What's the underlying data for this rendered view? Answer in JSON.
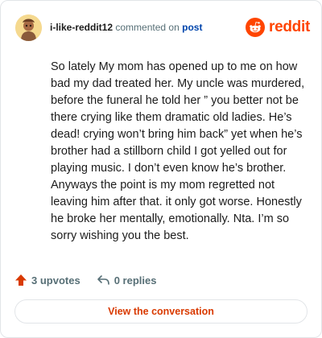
{
  "header": {
    "username": "i-like-reddit12",
    "commented_text": "commented on",
    "post_link": "post",
    "brand_name": "reddit",
    "brand_color": "#ff4500",
    "avatar_icon": "cartoon-avatar-icon",
    "brand_icon": "reddit-alien-icon"
  },
  "comment": {
    "body": "So lately My mom has opened up to me on how bad my dad treated her. My uncle was murdered, before the funeral he told her ” you better not be there crying like them dramatic old ladies. He’s dead! crying won’t bring him back” yet when he’s brother had a stillborn child I got yelled out for playing music. I don’t even know he’s brother. Anyways the point is my mom regretted not leaving him after that. it only got worse. Honestly he broke her mentally, emotionally. Nta. I’m so sorry wishing you the best."
  },
  "footer": {
    "upvotes_label": "3 upvotes",
    "replies_label": "0 replies",
    "upvote_icon": "upvote-arrow-icon",
    "reply_icon": "reply-arrow-icon",
    "upvote_color": "#d93a00"
  },
  "cta": {
    "label": "View the conversation",
    "color": "#d93a00"
  }
}
